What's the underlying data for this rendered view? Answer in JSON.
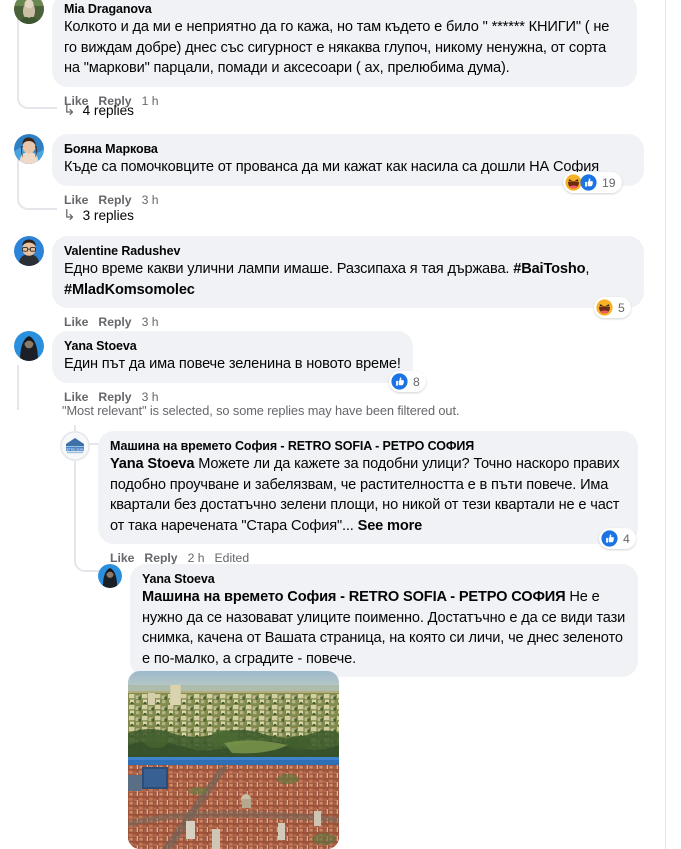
{
  "app": {
    "name": "facebook-comments-thread"
  },
  "comments": [
    {
      "id": "c1",
      "author": "Mia Draganova",
      "text": "Колкото и да ми е неприятно да го кажа, но там където е било \" ****** КНИГИ\" ( не го виждам добре) днес със сигурност е някаква глупоч, никому ненужна, от сорта на \"маркови\" парцали, помади и аксесоари ( ах, прелюбима дума).",
      "like_label": "Like",
      "reply_label": "Reply",
      "timestamp": "1 h",
      "replies_label": "4 replies",
      "reactions": null
    },
    {
      "id": "c2",
      "author": "Бояна Маркова",
      "text": "Къде са помочковците от прованса да ми кажат как насила са дошли НА София",
      "like_label": "Like",
      "reply_label": "Reply",
      "timestamp": "3 h",
      "replies_label": "3 replies",
      "reactions": {
        "count": "19",
        "icons": [
          "haha-icon",
          "like-icon"
        ]
      }
    },
    {
      "id": "c3",
      "author": "Valentine Radushev",
      "text_pre": "Едно време какви улични лампи имаше. Разсипаха я тая държава. ",
      "hashtag1": "#BaiTosho",
      "text_mid": ", ",
      "hashtag2": "#MladKomsomolec",
      "like_label": "Like",
      "reply_label": "Reply",
      "timestamp": "3 h",
      "reactions": {
        "count": "5",
        "icons": [
          "haha-icon"
        ]
      }
    },
    {
      "id": "c4",
      "author": "Yana Stoeva",
      "text": "Един път да има повече зеленина в новото време!",
      "like_label": "Like",
      "reply_label": "Reply",
      "timestamp": "3 h",
      "reactions": {
        "count": "8",
        "icons": [
          "like-icon"
        ]
      }
    }
  ],
  "filter_notice": "\"Most relevant\" is selected, so some replies may have been filtered out.",
  "replies": [
    {
      "id": "r1",
      "author": "Машина на времето София - RETRO SOFIA - РЕТРО СОФИЯ",
      "mention": "Yana Stoeva",
      "text": " Можете ли да кажете за подобни улици? Точно наскоро правих подобно проучване и забелязвам, че растителността е в пъти повече. Има квартали без достатъчно зелени площи, но никой от тези квартали не е част от така наречената \"Стара София\"...",
      "see_more": "See more",
      "like_label": "Like",
      "reply_label": "Reply",
      "timestamp": "2 h",
      "edited_label": "Edited",
      "reactions": {
        "count": "4",
        "icons": [
          "like-icon"
        ]
      }
    },
    {
      "id": "r2",
      "author": "Yana Stoeva",
      "mention": "Машина на времето София - RETRO SOFIA - РЕТРО СОФИЯ",
      "text": " Не е нужно да се назовават улиците поименно. Достатъчно е да се види тази снимка, качена от Вашата страница, на която си личи, че днес зеленото е по-малко, а сградите - повече.",
      "attachment": {
        "name": "aerial-city-photo",
        "description": "Aerial split photo of Sofia: upper half green leafy city, lower half dense red rooftops"
      }
    }
  ],
  "colors": {
    "bubble_bg": "#f0f2f5",
    "text_primary": "#050505",
    "text_secondary": "#65676b",
    "thread_line": "#e4e6eb",
    "like_blue": "#1b74e4",
    "haha_yellow": "#f7b125",
    "page_bg": "#ffffff"
  }
}
